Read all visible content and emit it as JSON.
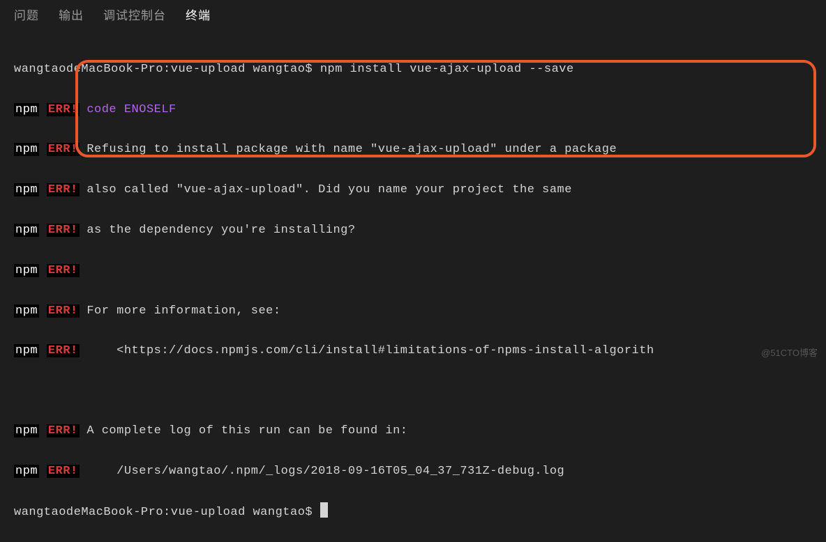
{
  "tabs": {
    "problems": "问题",
    "output": "输出",
    "debug_console": "调试控制台",
    "terminal": "终端"
  },
  "terminal": {
    "prompt_host": "wangtaodeMacBook-Pro",
    "prompt_path": "vue-upload",
    "prompt_user": "wangtao",
    "command": "npm install vue-ajax-upload --save",
    "npm_label": "npm",
    "err_label": "ERR!",
    "err_code_key": "code",
    "err_code_val": "ENOSELF",
    "msg_line1": "Refusing to install package with name \"vue-ajax-upload\" under a package",
    "msg_line2": "also called \"vue-ajax-upload\". Did you name your project the same",
    "msg_line3": "as the dependency you're installing?",
    "msg_line5": "For more information, see:",
    "msg_line6": "    <https://docs.npmjs.com/cli/install#limitations-of-npms-install-algorith",
    "msg_line7": "A complete log of this run can be found in:",
    "msg_line8": "    /Users/wangtao/.npm/_logs/2018-09-16T05_04_37_731Z-debug.log"
  },
  "watermark": "@51CTO博客"
}
